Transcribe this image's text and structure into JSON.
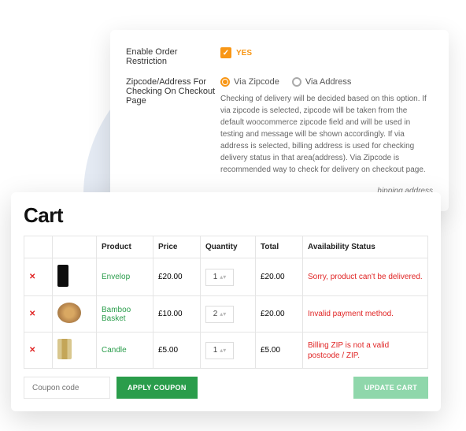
{
  "settings": {
    "enable_label": "Enable Order Restriction",
    "yes_label": "YES",
    "zipcode_label": "Zipcode/Address For Checking On Checkout Page",
    "radio_via_zipcode": "Via Zipcode",
    "radio_via_address": "Via Address",
    "help_text": "Checking of delivery will be decided based on this option. If via zipcode is selected, zipcode will be taken from the default woocommerce zipcode field and will be used in testing and message will be shown accordingly. If via address is selected, billing address is used for checking delivery status in that area(address). Via Zipcode is recommended way to check for delivery on checkout page.",
    "ship_note": "hipping address"
  },
  "cart": {
    "title": "Cart",
    "headers": {
      "product": "Product",
      "price": "Price",
      "quantity": "Quantity",
      "total": "Total",
      "availability": "Availability Status"
    },
    "rows": [
      {
        "name": "Envelop",
        "price": "£20.00",
        "qty": "1",
        "total": "£20.00",
        "status": "Sorry, product can't be delivered."
      },
      {
        "name": "Bamboo Basket",
        "price": "£10.00",
        "qty": "2",
        "total": "£20.00",
        "status": "Invalid payment method."
      },
      {
        "name": "Candle",
        "price": "£5.00",
        "qty": "1",
        "total": "£5.00",
        "status": "Billing ZIP is not a valid postcode / ZIP."
      }
    ],
    "coupon_placeholder": "Coupon code",
    "apply_label": "APPLY COUPON",
    "update_label": "UPDATE CART"
  }
}
